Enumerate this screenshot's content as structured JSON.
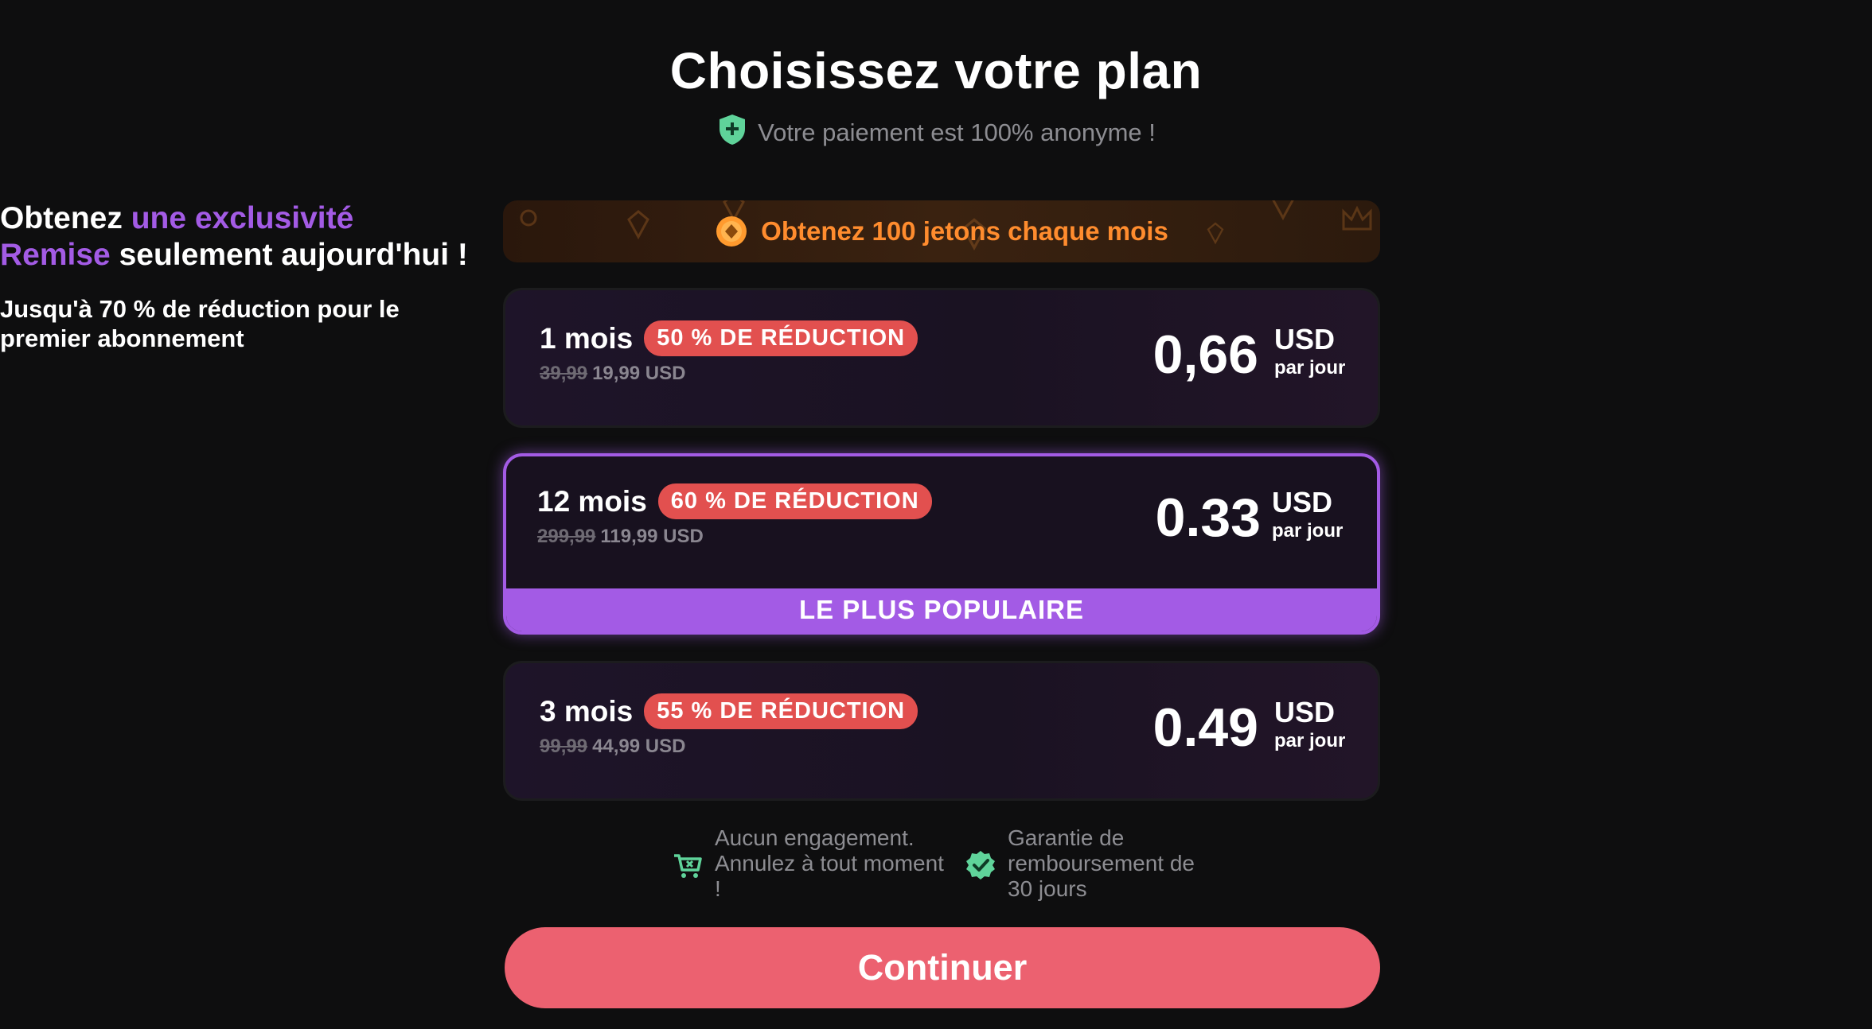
{
  "header": {
    "title": "Choisissez votre plan",
    "anon_text": "Votre paiement est 100% anonyme !",
    "anon_icon": "shield-plus-icon"
  },
  "promo": {
    "part1": "Obtenez ",
    "part2": "une exclusivité Remise",
    "part3": " seulement aujourd'hui !",
    "subtitle": "Jusqu'à 70 % de réduction pour le premier abonnement"
  },
  "tokens_banner": {
    "text": "Obtenez 100 jetons chaque mois",
    "icon": "coin-icon"
  },
  "plans": [
    {
      "name": "1 mois",
      "badge": "50 % DE RÉDUCTION",
      "old_price": "39,99",
      "new_price": "19,99 USD",
      "daily_price": "0,66",
      "currency": "USD",
      "per": "par jour",
      "selected": false
    },
    {
      "name": "12 mois",
      "badge": "60 % DE RÉDUCTION",
      "old_price": "299,99",
      "new_price": "119,99 USD",
      "daily_price": "0.33",
      "currency": "USD",
      "per": "par jour",
      "selected": true,
      "ribbon": "LE PLUS POPULAIRE"
    },
    {
      "name": "3 mois",
      "badge": "55 % DE RÉDUCTION",
      "old_price": "99,99",
      "new_price": "44,99 USD",
      "daily_price": "0.49",
      "currency": "USD",
      "per": "par jour",
      "selected": false
    }
  ],
  "guarantees": {
    "no_commitment": "Aucun engagement. Annulez à tout moment !",
    "refund": "Garantie de remboursement de 30 jours"
  },
  "cta": {
    "label": "Continuer"
  },
  "colors": {
    "background": "#0e0e0f",
    "accent_purple": "#a35be5",
    "badge_red": "#e2504f",
    "cta_pink": "#ec6170",
    "token_orange": "#ff8c2e",
    "check_green": "#5fd39a"
  }
}
